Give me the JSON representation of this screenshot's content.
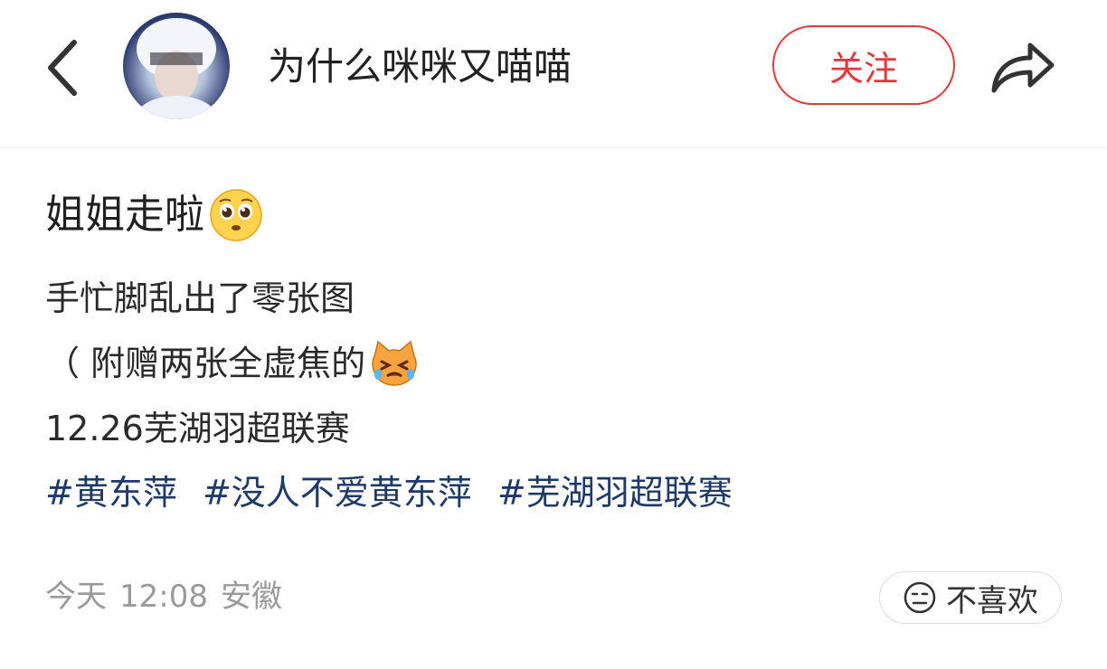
{
  "header": {
    "username": "为什么咪咪又喵喵",
    "follow_label": "关注",
    "icons": {
      "back": "back-arrow-icon",
      "share": "share-arrow-icon"
    }
  },
  "post": {
    "title": "姐姐走啦",
    "title_emoji": "pleading-face-emoji",
    "lines": [
      "手忙脚乱出了零张图",
      "（ 附赠两张全虚焦的",
      "12.26芜湖羽超联赛"
    ],
    "line2_emoji": "crying-cat-emoji",
    "tags": [
      "#黄东萍",
      "#没人不爱黄东萍",
      "#芜湖羽超联赛"
    ]
  },
  "meta": {
    "date": "今天",
    "time": "12:08",
    "location": "安徽"
  },
  "dislike": {
    "label": "不喜欢",
    "icon": "neutral-face-icon"
  },
  "colors": {
    "accent_red": "#e4393c",
    "tag_blue": "#1e3a6b",
    "meta_gray": "#9a9a9a"
  }
}
